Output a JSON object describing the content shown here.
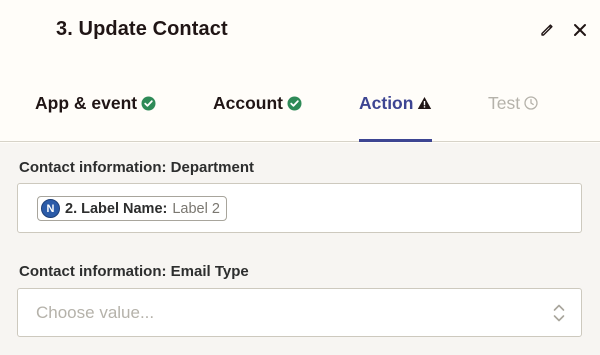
{
  "header": {
    "title": "3. Update Contact",
    "edit_icon": "pencil-icon",
    "close_icon": "close-icon"
  },
  "tabs": [
    {
      "label": "App & event",
      "status": "check-circle-icon",
      "status_color": "#2e8a57"
    },
    {
      "label": "Account",
      "status": "check-circle-icon",
      "status_color": "#2e8a57"
    },
    {
      "label": "Action",
      "status": "warning-triangle-icon",
      "status_color": "#201515",
      "active": true,
      "accent": "#3d4592"
    },
    {
      "label": "Test",
      "status": "clock-icon",
      "status_color": "#b5b2aa"
    }
  ],
  "fields": {
    "department": {
      "label": "Contact information: Department",
      "pill": {
        "badge": "N",
        "key": "2. Label Name:",
        "value": "Label 2"
      }
    },
    "email_type": {
      "label": "Contact information: Email Type",
      "placeholder": "Choose value..."
    }
  }
}
